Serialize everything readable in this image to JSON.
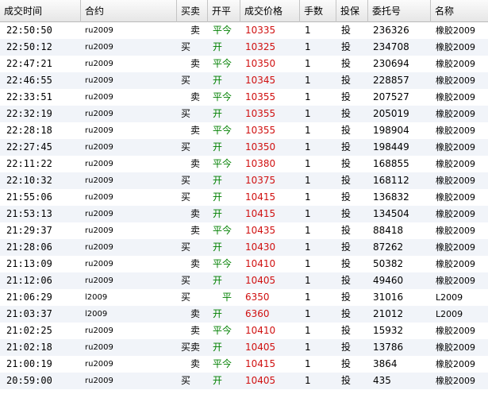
{
  "columns": [
    "成交时间",
    "合约",
    "买卖",
    "开平",
    "成交价格",
    "手数",
    "投保",
    "委托号",
    "名称"
  ],
  "rows": [
    {
      "time": "22:50:50",
      "symbol": "ru2009",
      "side": "卖",
      "offset": "平今",
      "price": "10335",
      "qty": "1",
      "hedge": "投",
      "order": "236326",
      "name": "橡胶2009"
    },
    {
      "time": "22:50:12",
      "symbol": "ru2009",
      "side": "买",
      "offset": "开",
      "price": "10325",
      "qty": "1",
      "hedge": "投",
      "order": "234708",
      "name": "橡胶2009"
    },
    {
      "time": "22:47:21",
      "symbol": "ru2009",
      "side": "卖",
      "offset": "平今",
      "price": "10350",
      "qty": "1",
      "hedge": "投",
      "order": "230694",
      "name": "橡胶2009"
    },
    {
      "time": "22:46:55",
      "symbol": "ru2009",
      "side": "买",
      "offset": "开",
      "price": "10345",
      "qty": "1",
      "hedge": "投",
      "order": "228857",
      "name": "橡胶2009"
    },
    {
      "time": "22:33:51",
      "symbol": "ru2009",
      "side": "卖",
      "offset": "平今",
      "price": "10355",
      "qty": "1",
      "hedge": "投",
      "order": "207527",
      "name": "橡胶2009"
    },
    {
      "time": "22:32:19",
      "symbol": "ru2009",
      "side": "买",
      "offset": "开",
      "price": "10355",
      "qty": "1",
      "hedge": "投",
      "order": "205019",
      "name": "橡胶2009"
    },
    {
      "time": "22:28:18",
      "symbol": "ru2009",
      "side": "卖",
      "offset": "平今",
      "price": "10355",
      "qty": "1",
      "hedge": "投",
      "order": "198904",
      "name": "橡胶2009"
    },
    {
      "time": "22:27:45",
      "symbol": "ru2009",
      "side": "买",
      "offset": "开",
      "price": "10350",
      "qty": "1",
      "hedge": "投",
      "order": "198449",
      "name": "橡胶2009"
    },
    {
      "time": "22:11:22",
      "symbol": "ru2009",
      "side": "卖",
      "offset": "平今",
      "price": "10380",
      "qty": "1",
      "hedge": "投",
      "order": "168855",
      "name": "橡胶2009"
    },
    {
      "time": "22:10:32",
      "symbol": "ru2009",
      "side": "买",
      "offset": "开",
      "price": "10375",
      "qty": "1",
      "hedge": "投",
      "order": "168112",
      "name": "橡胶2009"
    },
    {
      "time": "21:55:06",
      "symbol": "ru2009",
      "side": "买",
      "offset": "开",
      "price": "10415",
      "qty": "1",
      "hedge": "投",
      "order": "136832",
      "name": "橡胶2009"
    },
    {
      "time": "21:53:13",
      "symbol": "ru2009",
      "side": "卖",
      "offset": "开",
      "price": "10415",
      "qty": "1",
      "hedge": "投",
      "order": "134504",
      "name": "橡胶2009"
    },
    {
      "time": "21:29:37",
      "symbol": "ru2009",
      "side": "卖",
      "offset": "平今",
      "price": "10435",
      "qty": "1",
      "hedge": "投",
      "order": "88418",
      "name": "橡胶2009"
    },
    {
      "time": "21:28:06",
      "symbol": "ru2009",
      "side": "买",
      "offset": "开",
      "price": "10430",
      "qty": "1",
      "hedge": "投",
      "order": "87262",
      "name": "橡胶2009"
    },
    {
      "time": "21:13:09",
      "symbol": "ru2009",
      "side": "卖",
      "offset": "平今",
      "price": "10410",
      "qty": "1",
      "hedge": "投",
      "order": "50382",
      "name": "橡胶2009"
    },
    {
      "time": "21:12:06",
      "symbol": "ru2009",
      "side": "买",
      "offset": "开",
      "price": "10405",
      "qty": "1",
      "hedge": "投",
      "order": "49460",
      "name": "橡胶2009"
    },
    {
      "time": "21:06:29",
      "symbol": "l2009",
      "side": "买",
      "offset": "平",
      "price": "6350",
      "qty": "1",
      "hedge": "投",
      "order": "31016",
      "name": "L2009"
    },
    {
      "time": "21:03:37",
      "symbol": "l2009",
      "side": "卖",
      "offset": "开",
      "price": "6360",
      "qty": "1",
      "hedge": "投",
      "order": "21012",
      "name": "L2009"
    },
    {
      "time": "21:02:25",
      "symbol": "ru2009",
      "side": "卖",
      "offset": "平今",
      "price": "10410",
      "qty": "1",
      "hedge": "投",
      "order": "15932",
      "name": "橡胶2009"
    },
    {
      "time": "21:02:18",
      "symbol": "ru2009",
      "side": "买卖",
      "offset": "开",
      "price": "10405",
      "qty": "1",
      "hedge": "投",
      "order": "13786",
      "name": "橡胶2009"
    },
    {
      "time": "21:00:19",
      "symbol": "ru2009",
      "side": "卖",
      "offset": "平今",
      "price": "10415",
      "qty": "1",
      "hedge": "投",
      "order": "3864",
      "name": "橡胶2009"
    },
    {
      "time": "20:59:00",
      "symbol": "ru2009",
      "side": "买",
      "offset": "开",
      "price": "10405",
      "qty": "1",
      "hedge": "投",
      "order": "435",
      "name": "橡胶2009"
    }
  ]
}
